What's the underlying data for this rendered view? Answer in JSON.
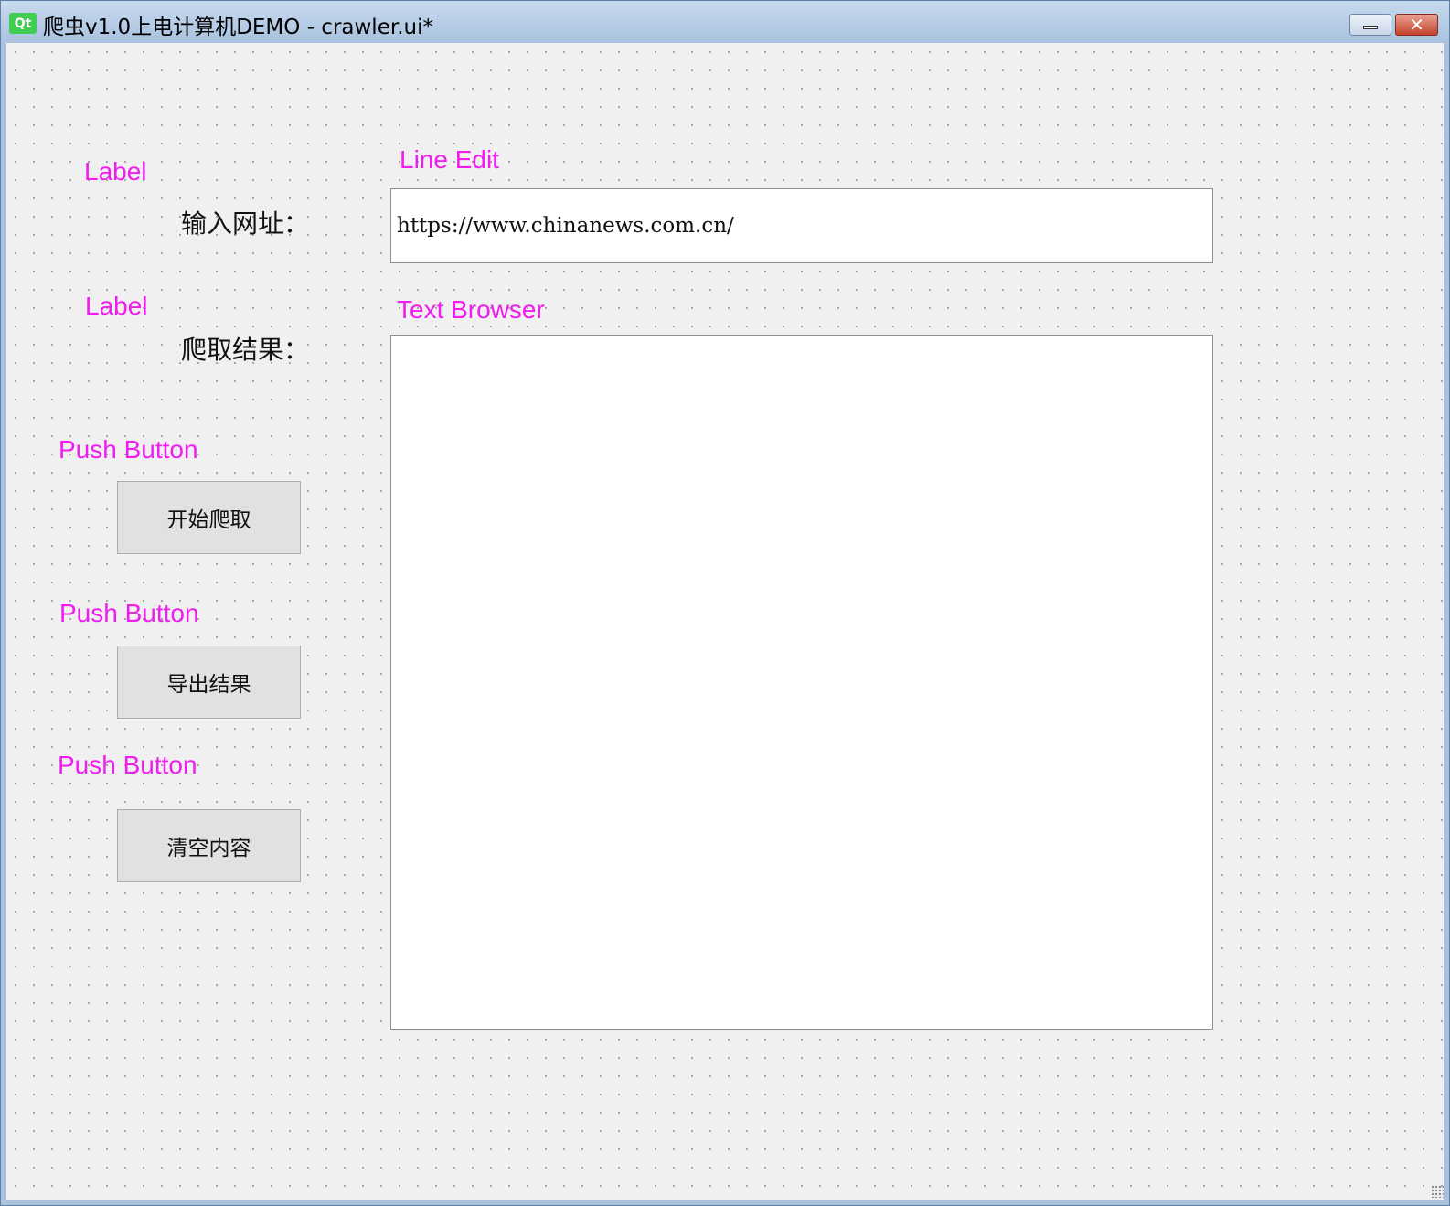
{
  "window": {
    "logo": "Qt",
    "title": "爬虫v1.0上电计算机DEMO - crawler.ui*",
    "close_glyph": "✕"
  },
  "form": {
    "url_label_hint": "Label",
    "url_label": "输入网址：",
    "line_edit_hint": "Line Edit",
    "url_value": "https://www.chinanews.com.cn/",
    "result_label_hint": "Label",
    "result_label": "爬取结果：",
    "text_browser_hint": "Text Browser",
    "buttons": [
      {
        "hint": "Push Button",
        "label": "开始爬取"
      },
      {
        "hint": "Push Button",
        "label": "导出结果"
      },
      {
        "hint": "Push Button",
        "label": "清空内容"
      }
    ]
  },
  "colors": {
    "designer_hint": "#f01cf0",
    "qt_green": "#41cd52",
    "canvas_bg": "#f0f0f0"
  }
}
